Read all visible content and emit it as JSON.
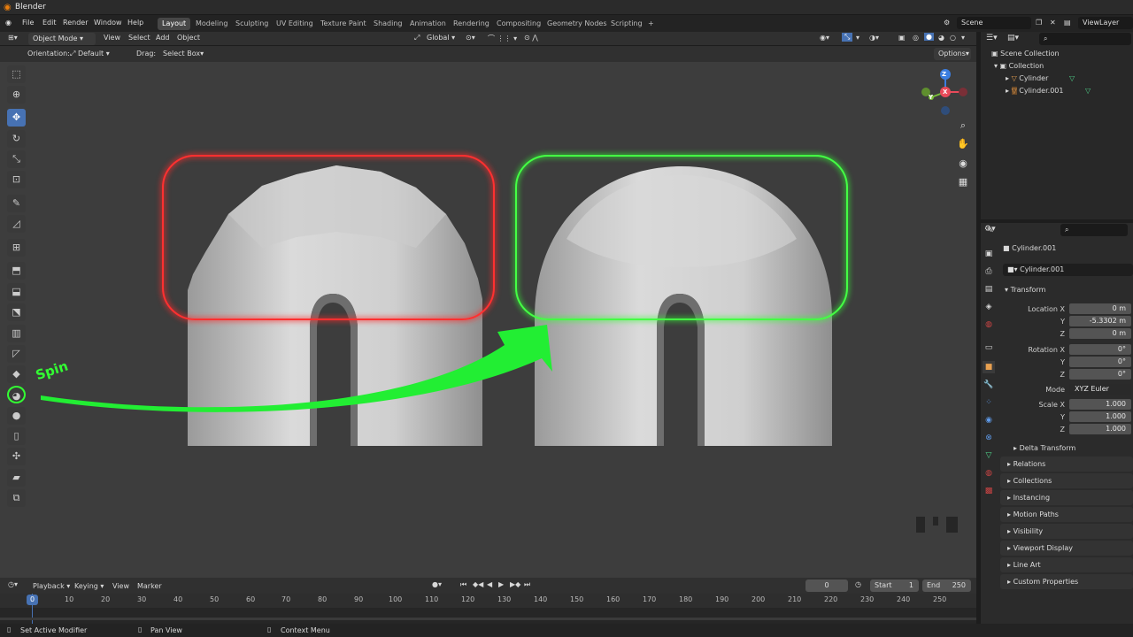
{
  "app": {
    "title": "Blender"
  },
  "menu": [
    "File",
    "Edit",
    "Render",
    "Window",
    "Help"
  ],
  "workspaces": [
    "Layout",
    "Modeling",
    "Sculpting",
    "UV Editing",
    "Texture Paint",
    "Shading",
    "Animation",
    "Rendering",
    "Compositing",
    "Geometry Nodes",
    "Scripting"
  ],
  "workspace_add": "+",
  "scene": {
    "name": "Scene",
    "view_layer": "ViewLayer"
  },
  "viewport_header": {
    "mode": "Object Mode",
    "items": [
      "View",
      "Select",
      "Add",
      "Object"
    ],
    "transform_orientation": "Global",
    "options": "Options"
  },
  "tool_settings": {
    "orientation_label": "Orientation:",
    "orientation_value": "Default",
    "drag_label": "Drag:",
    "drag_value": "Select Box"
  },
  "gizmo": {
    "x": "X",
    "y": "Y",
    "z": "Z"
  },
  "annotation": {
    "label": "Spin",
    "left_highlight_color": "#ff2222",
    "right_highlight_color": "#33ff33",
    "arrow_color": "#22ff44"
  },
  "outliner": {
    "root": "Scene Collection",
    "collection": "Collection",
    "objects": [
      "Cylinder",
      "Cylinder.001"
    ]
  },
  "properties": {
    "object_name": "Cylinder.001",
    "object_field": "Cylinder.001",
    "transform_label": "Transform",
    "location_label": "Location X",
    "location": {
      "x": "0 m",
      "y": "-5.3302 m",
      "z": "0 m"
    },
    "rotation_label": "Rotation X",
    "rotation": {
      "x": "0°",
      "y": "0°",
      "z": "0°"
    },
    "mode_label": "Mode",
    "mode_value": "XYZ Euler",
    "scale_label": "Scale X",
    "scale": {
      "x": "1.000",
      "y": "1.000",
      "z": "1.000"
    },
    "axis_y": "Y",
    "axis_z": "Z",
    "delta_transform": "Delta Transform",
    "panels": [
      "Relations",
      "Collections",
      "Instancing",
      "Motion Paths",
      "Visibility",
      "Viewport Display",
      "Line Art",
      "Custom Properties"
    ]
  },
  "timeline": {
    "menus": [
      "Playback",
      "Keying",
      "View",
      "Marker"
    ],
    "current_frame": "0",
    "start_label": "Start",
    "start": "1",
    "end_label": "End",
    "end": "250",
    "ticks": [
      "0",
      "10",
      "20",
      "30",
      "40",
      "50",
      "60",
      "70",
      "80",
      "90",
      "100",
      "110",
      "120",
      "130",
      "140",
      "150",
      "160",
      "170",
      "180",
      "190",
      "200",
      "210",
      "220",
      "230",
      "240",
      "250"
    ]
  },
  "status": {
    "left": "Set Active Modifier",
    "middle": "Pan View",
    "right": "Context Menu"
  }
}
